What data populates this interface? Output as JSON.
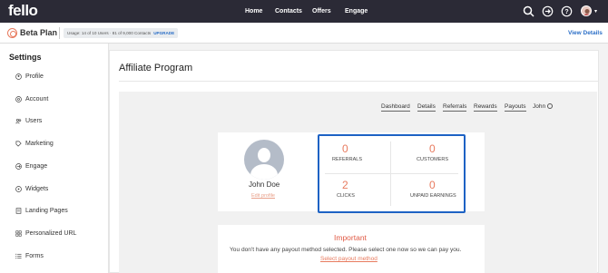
{
  "nav": {
    "logo": "fello",
    "links": [
      "Home",
      "Contacts",
      "Offers",
      "Engage"
    ]
  },
  "subbar": {
    "plan_name": "Beta Plan",
    "usage": "Usage: 14 of 10 Users · 81 of 9,000 Contacts",
    "upgrade": "UPGRADE",
    "view_details": "View Details"
  },
  "sidebar": {
    "title": "Settings",
    "items": [
      {
        "label": "Profile",
        "icon": "user-circle-icon"
      },
      {
        "label": "Account",
        "icon": "account-icon"
      },
      {
        "label": "Users",
        "icon": "users-icon"
      },
      {
        "label": "Marketing",
        "icon": "tag-icon"
      },
      {
        "label": "Engage",
        "icon": "engage-icon"
      },
      {
        "label": "Widgets",
        "icon": "widget-icon"
      },
      {
        "label": "Landing Pages",
        "icon": "page-icon"
      },
      {
        "label": "Personalized URL",
        "icon": "grid-icon"
      },
      {
        "label": "Forms",
        "icon": "list-icon"
      }
    ]
  },
  "main": {
    "title": "Affiliate Program",
    "tabs": [
      "Dashboard",
      "Details",
      "Referrals",
      "Rewards",
      "Payouts"
    ],
    "user_tab": "John",
    "profile": {
      "name": "John Doe",
      "edit": "Edit profile"
    },
    "stats": {
      "referrals": {
        "value": "0",
        "label": "REFERRALS"
      },
      "customers": {
        "value": "0",
        "label": "CUSTOMERS"
      },
      "clicks": {
        "value": "2",
        "label": "CLICKS"
      },
      "unpaid": {
        "value": "0",
        "label": "UNPAID EARNINGS"
      }
    },
    "important": {
      "title": "Important",
      "message": "You don't have any payout method selected. Please select one now so we can pay you.",
      "link": "Select payout method"
    }
  },
  "colors": {
    "topbar": "#2b2a36",
    "accent": "#e87b5f",
    "link": "#2b6fc7",
    "highlight_border": "#1d62c4"
  }
}
